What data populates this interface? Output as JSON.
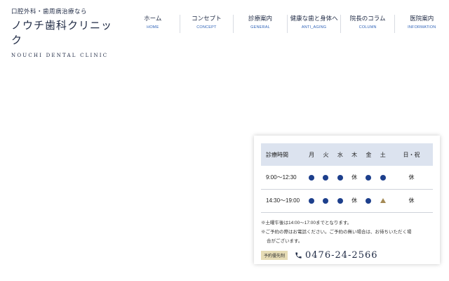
{
  "header": {
    "tagline": "口腔外科・歯周病治療なら",
    "clinic_name": "ノウチ歯科クリニック",
    "clinic_name_en": "NOUCHI DENTAL CLINIC"
  },
  "nav": [
    {
      "jp": "ホーム",
      "en": "HOME"
    },
    {
      "jp": "コンセプト",
      "en": "CONCEPT"
    },
    {
      "jp": "診療案内",
      "en": "GENERAL"
    },
    {
      "jp": "健康な歯と身体へ",
      "en": "ANTI_AGING"
    },
    {
      "jp": "院長のコラム",
      "en": "COLUMN"
    },
    {
      "jp": "医院案内",
      "en": "INFORMATION"
    }
  ],
  "schedule": {
    "header_label": "診療時間",
    "days": [
      "月",
      "火",
      "水",
      "木",
      "金",
      "土",
      "日・祝"
    ],
    "rows": [
      {
        "time": "9:00〜12:30",
        "cells": [
          "dot",
          "dot",
          "dot",
          "休",
          "dot",
          "dot",
          "休"
        ]
      },
      {
        "time": "14:30〜19:00",
        "cells": [
          "dot",
          "dot",
          "dot",
          "休",
          "dot",
          "triangle",
          "休"
        ]
      }
    ],
    "note1": "※土曜午後は14:00〜17:00までとなります。",
    "note2a": "※ご予約の際はお電話ください。ご予約の無い場合は、お待ちいただく場",
    "note2b": "合がございます。",
    "badge": "予約優先制",
    "phone": "0476-24-2566",
    "dot_color": "#1d3f8c",
    "triangle_color": "#a48a55"
  },
  "colors": {
    "accent_blue": "#2f63b8",
    "text_navy": "#1f2a44",
    "table_header_bg": "#dce3ef"
  }
}
